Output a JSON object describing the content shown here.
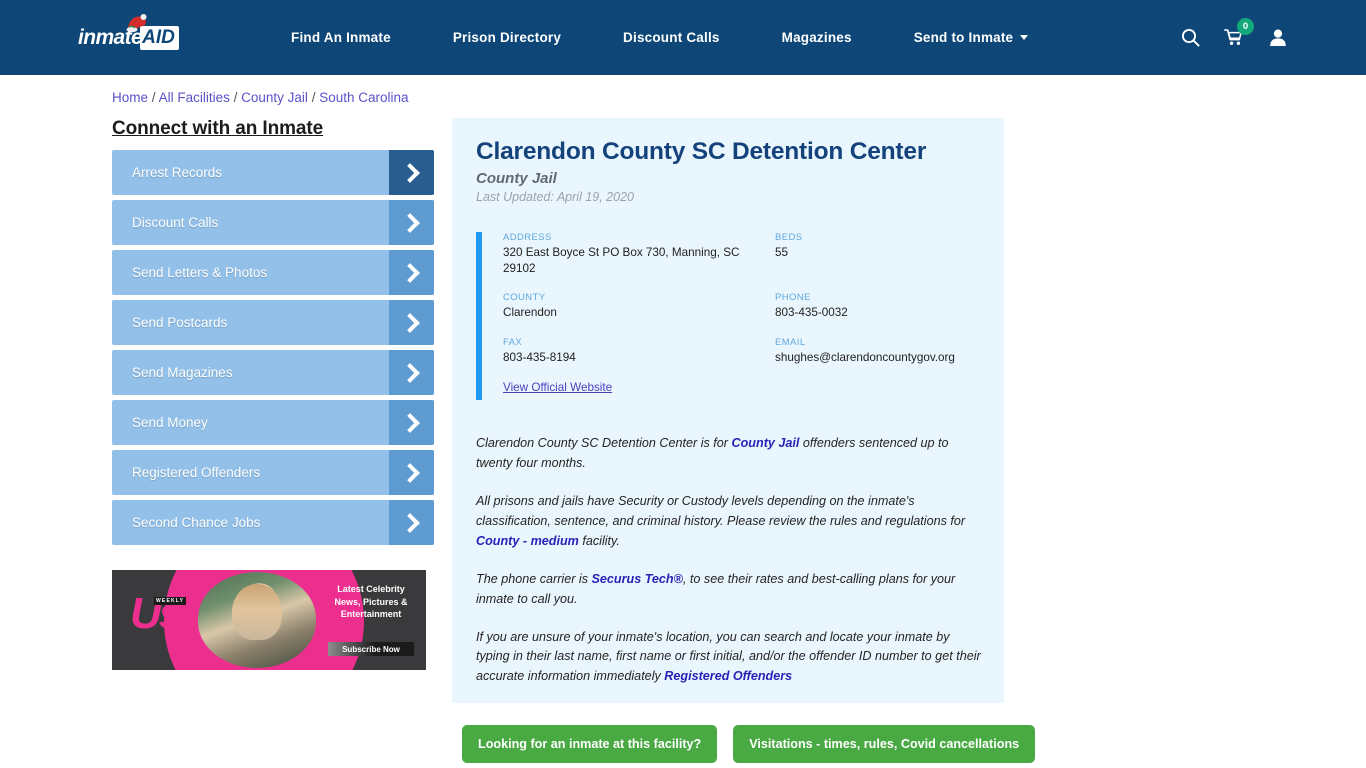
{
  "header": {
    "logo_word": "inmate",
    "logo_box": "AID",
    "nav": [
      {
        "label": "Find An Inmate",
        "caret": false
      },
      {
        "label": "Prison Directory",
        "caret": false
      },
      {
        "label": "Discount Calls",
        "caret": false
      },
      {
        "label": "Magazines",
        "caret": false
      },
      {
        "label": "Send to Inmate",
        "caret": true
      }
    ],
    "cart_count": "0",
    "colors": {
      "header_bg": "#0e4777",
      "cart_badge": "#12a87a"
    }
  },
  "breadcrumb": {
    "items": [
      "Home",
      "All Facilities",
      "County Jail",
      "South Carolina"
    ],
    "separator": "/"
  },
  "sidebar": {
    "title": "Connect with an Inmate",
    "items": [
      {
        "label": "Arrest Records",
        "active": true
      },
      {
        "label": "Discount Calls",
        "active": false
      },
      {
        "label": "Send Letters & Photos",
        "active": false
      },
      {
        "label": "Send Postcards",
        "active": false
      },
      {
        "label": "Send Magazines",
        "active": false
      },
      {
        "label": "Send Money",
        "active": false
      },
      {
        "label": "Registered Offenders",
        "active": false
      },
      {
        "label": "Second Chance Jobs",
        "active": false
      }
    ],
    "ad": {
      "brand": "Us",
      "brand_sub": "WEEKLY",
      "headline": "Latest Celebrity News, Pictures & Entertainment",
      "cta": "Subscribe Now"
    }
  },
  "facility": {
    "name": "Clarendon County SC Detention Center",
    "type": "County Jail",
    "updated": "Last Updated: April 19, 2020",
    "fields": [
      {
        "label": "ADDRESS",
        "value": "320 East Boyce St PO Box 730, Manning, SC 29102"
      },
      {
        "label": "BEDS",
        "value": "55"
      },
      {
        "label": "COUNTY",
        "value": "Clarendon"
      },
      {
        "label": "PHONE",
        "value": "803-435-0032"
      },
      {
        "label": "FAX",
        "value": "803-435-8194"
      },
      {
        "label": "EMAIL",
        "value": "shughes@clarendoncountygov.org"
      }
    ],
    "official_website_label": "View Official Website",
    "accent_bar_color": "#1e9bf0",
    "panel_bg": "#eaf6fd"
  },
  "description": {
    "p1_a": "Clarendon County SC Detention Center is for ",
    "p1_link": "County Jail",
    "p1_b": " offenders sentenced up to twenty four months.",
    "p2_a": "All prisons and jails have Security or Custody levels depending on the inmate's classification, sentence, and criminal history. Please review the rules and regulations for ",
    "p2_link": "County - medium",
    "p2_b": " facility.",
    "p3_a": "The phone carrier is ",
    "p3_link": "Securus Tech®",
    "p3_b": ", to see their rates and best-calling plans for your inmate to call you.",
    "p4_a": "If you are unsure of your inmate's location, you can search and locate your inmate by typing in their last name, first name or first initial, and/or the offender ID number to get their accurate information immediately ",
    "p4_link": "Registered Offenders"
  },
  "cta": {
    "inmate_search_label": "Looking for an inmate at this facility?",
    "visitation_label": "Visitations - times, rules, Covid cancellations",
    "color": "#49a942"
  }
}
